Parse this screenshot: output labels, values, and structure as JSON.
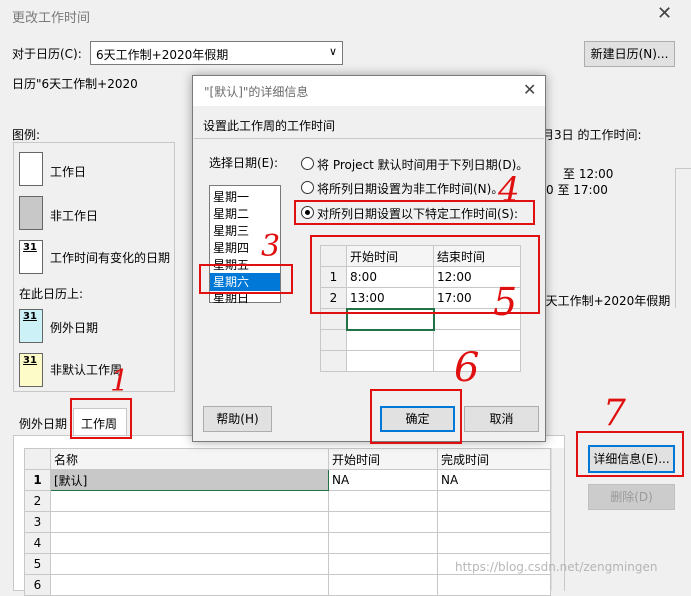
{
  "main_window": {
    "title": "更改工作时间",
    "calendar_label": "对于日历(C):",
    "calendar_value": "6天工作制+2020年假期",
    "new_calendar_btn": "新建日历(N)...",
    "calendar_caption": "日历\"6天工作制+2020",
    "legend_title": "图例:",
    "legend": {
      "workday": "工作日",
      "nonworkday": "非工作日",
      "changed_day": "工作时间有变化的日期",
      "on_this_calendar": "在此日历上:",
      "exception_day": "例外日期",
      "nondefault_week": "非默认工作周",
      "day_num": "31"
    },
    "right_panel": {
      "date_info": "月3日 的工作时间:",
      "time1": "至 12:00",
      "time2": "0 至 17:00",
      "based_on": "6天工作制+2020年假期"
    },
    "tabs": [
      "例外日期",
      "工作周"
    ],
    "week_table": {
      "headers": [
        "名称",
        "开始时间",
        "完成时间"
      ],
      "rows": [
        {
          "n": "1",
          "name": "[默认]",
          "start": "NA",
          "finish": "NA"
        },
        {
          "n": "2",
          "name": "",
          "start": "",
          "finish": ""
        },
        {
          "n": "3",
          "name": "",
          "start": "",
          "finish": ""
        },
        {
          "n": "4",
          "name": "",
          "start": "",
          "finish": ""
        },
        {
          "n": "5",
          "name": "",
          "start": "",
          "finish": ""
        },
        {
          "n": "6",
          "name": "",
          "start": "",
          "finish": ""
        }
      ]
    },
    "details_btn": "详细信息(E)...",
    "delete_btn": "删除(D)"
  },
  "dialog": {
    "title": "\"[默认]\"的详细信息",
    "subtitle": "设置此工作周的工作时间",
    "select_day_label": "选择日期(E):",
    "days": [
      "星期一",
      "星期二",
      "星期三",
      "星期四",
      "星期五",
      "星期六",
      "星期日"
    ],
    "selected_day_index": 5,
    "radio": [
      "将 Project 默认时间用于下列日期(D)。",
      "将所列日期设置为非工作时间(N)。",
      "对所列日期设置以下特定工作时间(S):"
    ],
    "selected_radio": 2,
    "time_table": {
      "headers": [
        "开始时间",
        "结束时间"
      ],
      "rows": [
        {
          "n": "1",
          "start": "8:00",
          "end": "12:00"
        },
        {
          "n": "2",
          "start": "13:00",
          "end": "17:00"
        }
      ]
    },
    "help_btn": "帮助(H)",
    "ok_btn": "确定",
    "cancel_btn": "取消"
  },
  "annotations": [
    "1",
    "3",
    "4",
    "5",
    "6",
    "7"
  ],
  "watermark": "https://blog.csdn.net/zengmingen",
  "colors": {
    "annotation": "#e01010",
    "selection": "#0078d7"
  }
}
